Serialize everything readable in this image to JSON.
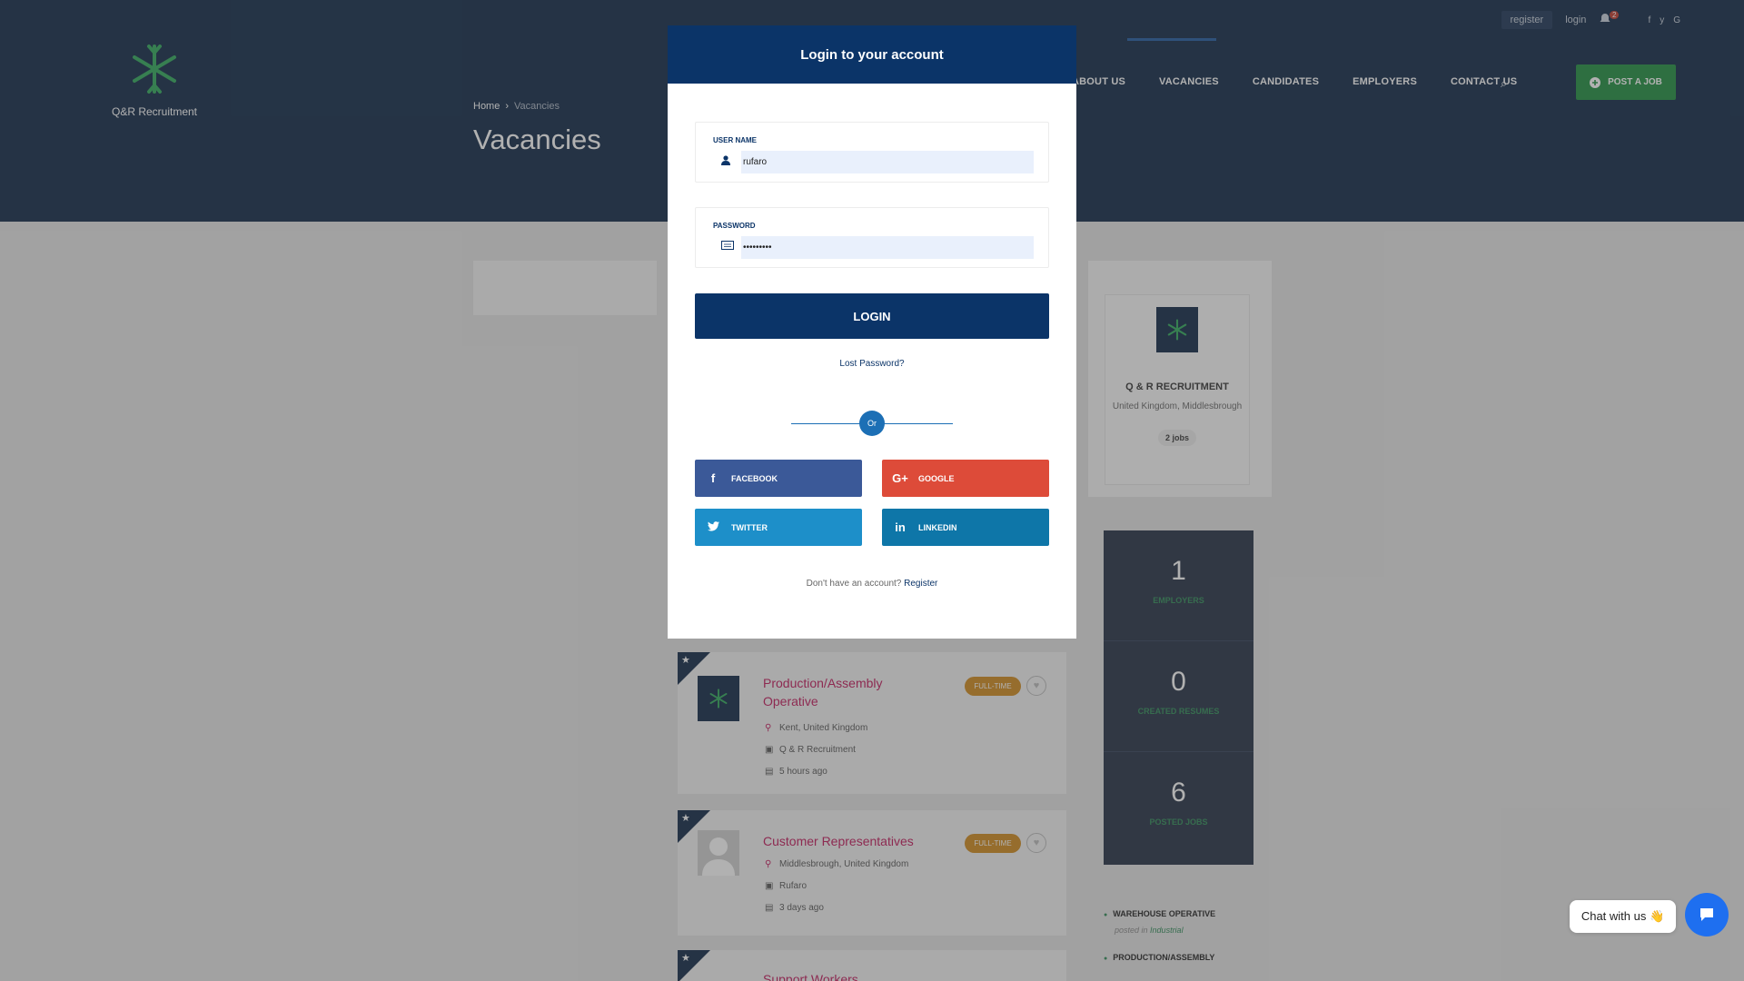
{
  "topbar": {
    "register": "register",
    "login": "login",
    "notif_count": "2",
    "social": [
      "f",
      "y",
      "G"
    ]
  },
  "brand": {
    "name": "Q&R Recruitment"
  },
  "nav": {
    "items": [
      "ABOUT US",
      "VACANCIES",
      "CANDIDATES",
      "EMPLOYERS",
      "CONTACT US"
    ],
    "post_job": "POST A JOB"
  },
  "breadcrumb": {
    "home": "Home",
    "current": "Vacancies"
  },
  "page_title": "Vacancies",
  "company": {
    "name": "Q & R RECRUITMENT",
    "location": "United Kingdom, Middlesbrough",
    "jobs": "2 jobs",
    "logo_text": "Q&R Recruitment"
  },
  "stats": [
    {
      "num": "1",
      "label": "EMPLOYERS"
    },
    {
      "num": "0",
      "label": "CREATED RESUMES"
    },
    {
      "num": "6",
      "label": "POSTED JOBS"
    }
  ],
  "side_list": [
    {
      "title": "WAREHOUSE OPERATIVE",
      "posted_prefix": "posted in",
      "category": "Industrial"
    },
    {
      "title": "PRODUCTION/ASSEMBLY"
    }
  ],
  "jobs": [
    {
      "title": "Production/Assembly Operative",
      "type": "FULL-TIME",
      "location": "Kent, United Kingdom",
      "company": "Q & R Recruitment",
      "time": "5 hours ago"
    },
    {
      "title": "Customer Representatives",
      "type": "FULL-TIME",
      "location": "Middlesbrough, United Kingdom",
      "company": "Rufaro",
      "time": "3 days ago"
    },
    {
      "title": "Support Workers"
    }
  ],
  "chat": {
    "label": "Chat with us 👋"
  },
  "modal": {
    "title": "Login to your account",
    "username_label": "USER NAME",
    "username_value": "rufaro",
    "password_label": "PASSWORD",
    "password_value": "•••••••••",
    "login_button": "LOGIN",
    "lost_password": "Lost Password?",
    "or": "Or",
    "facebook": "FACEBOOK",
    "google": "GOOGLE",
    "twitter": "TWITTER",
    "linkedin": "LINKEDIN",
    "no_account": "Don't have an account?",
    "register_link": "Register"
  },
  "colors": {
    "header": "#0e2746",
    "modal_primary": "#0b3468",
    "facebook": "#3b5998",
    "google": "#dd4b39",
    "twitter": "#1d8fc9",
    "linkedin": "#0e76a8",
    "accent_green": "#1e8e3e",
    "job_title": "#c2185b"
  }
}
